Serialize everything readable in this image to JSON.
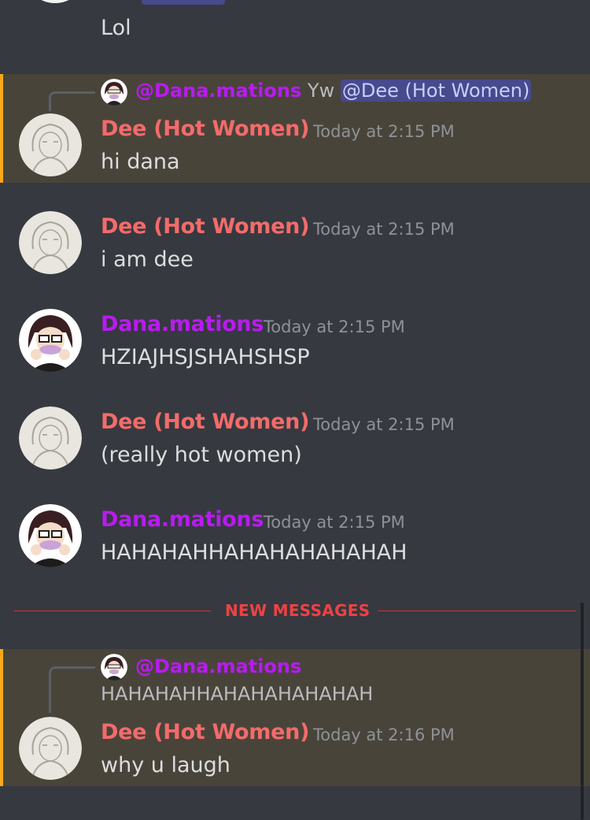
{
  "messages": {
    "m0": {
      "text": "Lol"
    },
    "m1": {
      "reply_author": "@Dana.mations",
      "reply_text": "Yw",
      "reply_mention": "@Dee (Hot Women)",
      "author": "Dee (Hot Women)",
      "timestamp": "Today at 2:15 PM",
      "text": "hi dana"
    },
    "m2": {
      "author": "Dee (Hot Women)",
      "timestamp": "Today at 2:15 PM",
      "text": "i am dee"
    },
    "m3": {
      "author": "Dana.mations",
      "timestamp": "Today at 2:15 PM",
      "text": "HZIAJHSJSHAHSHSP"
    },
    "m4": {
      "author": "Dee (Hot Women)",
      "timestamp": "Today at 2:15 PM",
      "text": "(really hot women)"
    },
    "m5": {
      "author": "Dana.mations",
      "timestamp": "Today at 2:15 PM",
      "text": "HAHAHAHHAHAHAHAHAHAH"
    },
    "m6": {
      "reply_author": "@Dana.mations",
      "reply_text": "HAHAHAHHAHAHAHAHAHAH",
      "author": "Dee (Hot Women)",
      "timestamp": "Today at 2:16 PM",
      "text": "why u laugh"
    }
  },
  "divider": {
    "label": "NEW MESSAGES"
  },
  "colors": {
    "background": "#36393f",
    "highlight": "#49443a",
    "highlight_bar": "#faa81a",
    "dee_name": "#f36b6b",
    "dana_name": "#b81bf0",
    "divider": "#ed4245",
    "mention_bg": "#474a8c"
  },
  "icons": {
    "dee_avatar": "sketch-avatar",
    "dana_avatar": "cartoon-avatar"
  }
}
